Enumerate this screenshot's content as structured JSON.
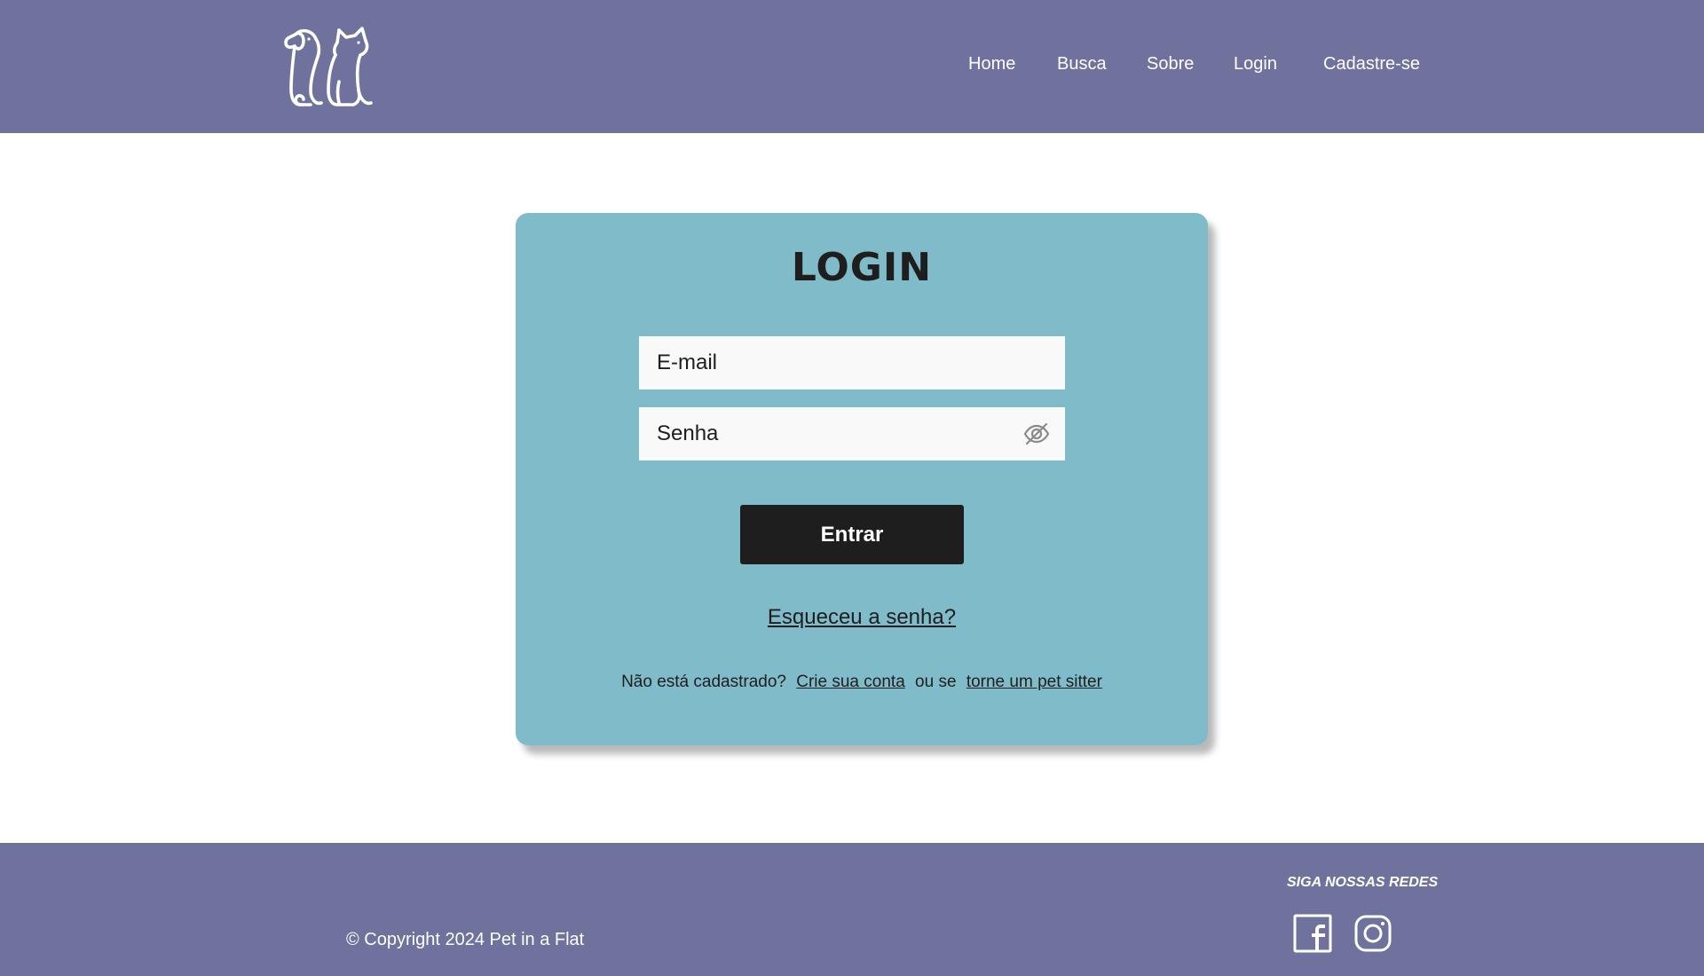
{
  "header": {
    "nav": [
      {
        "label": "Home"
      },
      {
        "label": "Busca"
      },
      {
        "label": "Sobre"
      },
      {
        "label": "Login"
      },
      {
        "label": "Cadastre-se"
      }
    ]
  },
  "login": {
    "title": "LOGIN",
    "email_placeholder": "E-mail",
    "password_placeholder": "Senha",
    "submit_label": "Entrar",
    "forgot_label": "Esqueceu a senha?",
    "signup_prefix": "Não está cadastrado?",
    "signup_link": "Crie sua conta",
    "signup_middle": "ou se",
    "petsitter_link": "torne um pet sitter"
  },
  "footer": {
    "copyright": "© Copyright 2024 Pet in a Flat",
    "social_title": "SIGA NOSSAS REDES",
    "social_icons": [
      "facebook-icon",
      "instagram-icon"
    ]
  },
  "colors": {
    "header_bg": "#6e729d",
    "card_bg": "#80bbca",
    "button_bg": "#1e1e1e",
    "input_bg": "#f9f9f9"
  },
  "icons": {
    "logo": "dog-and-cat-logo",
    "password_toggle": "eye-off-icon"
  }
}
